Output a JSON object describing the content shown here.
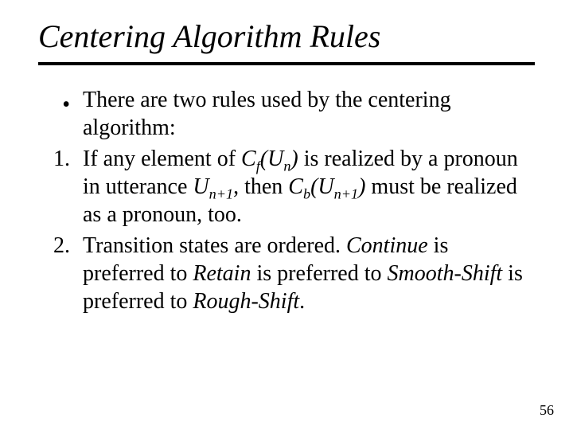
{
  "title": "Centering Algorithm Rules",
  "bullets": {
    "intro_marker": "•",
    "intro_text": "There are two rules used by the centering algorithm:",
    "one_marker": "1.",
    "one_a": "If any element of ",
    "one_cf": "C",
    "one_cf_sub": "f",
    "one_paren_un_open": "(U",
    "one_un_sub": "n",
    "one_paren_close": ")",
    "one_b": " is realized by a pronoun in utterance ",
    "one_un1": "U",
    "one_un1_sub": "n+1",
    "one_c": ", then ",
    "one_cb": "C",
    "one_cb_sub": "b",
    "one_paren_un1_open": "(U",
    "one_un1b_sub": "n+1",
    "one_paren_close2": ")",
    "one_d": " must be realized as a pronoun, too.",
    "two_marker": "2.",
    "two_a": "Transition states are ordered. ",
    "two_continue": "Continue",
    "two_b": " is preferred to ",
    "two_retain": "Retain",
    "two_c": " is preferred to ",
    "two_smooth": "Smooth-Shift",
    "two_d": " is preferred to ",
    "two_rough": "Rough-Shift",
    "two_e": "."
  },
  "page_number": "56"
}
